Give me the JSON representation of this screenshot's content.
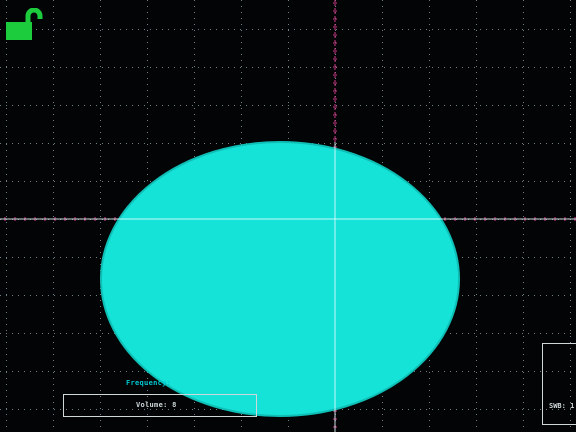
{
  "screen": {
    "background_color": "#020405",
    "grid_dot_color": "#6f7f86",
    "axis_color": "#d63a8a",
    "cursor_color": "#e6ffff",
    "trace_color": "#16e3d8"
  },
  "lock_indicator": {
    "icon": "unlocked-padlock-icon",
    "color": "#1ccc3c"
  },
  "readouts": {
    "frequency_label": "Frequency:",
    "volume_label": "Volume: 8",
    "side_label": "SWB: 1"
  }
}
